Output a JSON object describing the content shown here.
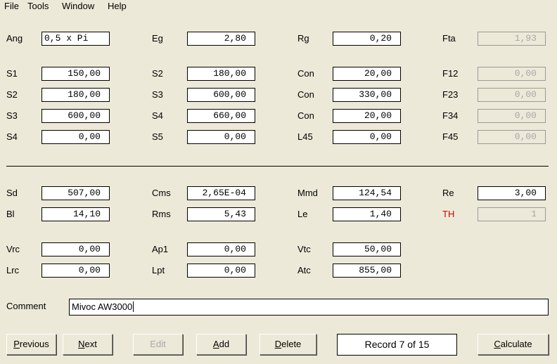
{
  "menu": [
    "File",
    "Tools",
    "Window",
    "Help"
  ],
  "params": {
    "ang": {
      "label": "Ang",
      "value": "0,5 x Pi"
    },
    "eg": {
      "label": "Eg",
      "value": "2,80"
    },
    "rg": {
      "label": "Rg",
      "value": "0,20"
    },
    "fta": {
      "label": "Fta",
      "value": "1,93"
    }
  },
  "segments": [
    {
      "s_a": "S1",
      "v_a": "150,00",
      "s_b": "S2",
      "v_b": "180,00",
      "con": "Con",
      "v_con": "20,00",
      "f": "F12",
      "v_f": "0,00"
    },
    {
      "s_a": "S2",
      "v_a": "180,00",
      "s_b": "S3",
      "v_b": "600,00",
      "con": "Con",
      "v_con": "330,00",
      "f": "F23",
      "v_f": "0,00"
    },
    {
      "s_a": "S3",
      "v_a": "600,00",
      "s_b": "S4",
      "v_b": "660,00",
      "con": "Con",
      "v_con": "20,00",
      "f": "F34",
      "v_f": "0,00"
    },
    {
      "s_a": "S4",
      "v_a": "0,00",
      "s_b": "S5",
      "v_b": "0,00",
      "con": "L45",
      "v_con": "0,00",
      "f": "F45",
      "v_f": "0,00"
    }
  ],
  "driver": {
    "sd": {
      "label": "Sd",
      "value": "507,00"
    },
    "cms": {
      "label": "Cms",
      "value": "2,65E-04"
    },
    "mmd": {
      "label": "Mmd",
      "value": "124,54"
    },
    "re": {
      "label": "Re",
      "value": "3,00"
    },
    "bl": {
      "label": "Bl",
      "value": "14,10"
    },
    "rms": {
      "label": "Rms",
      "value": "5,43"
    },
    "le": {
      "label": "Le",
      "value": "1,40"
    },
    "th": {
      "label": "TH",
      "value": "1",
      "label_color": "#d40000"
    }
  },
  "enclosure": {
    "vrc": {
      "label": "Vrc",
      "value": "0,00"
    },
    "ap1": {
      "label": "Ap1",
      "value": "0,00"
    },
    "vtc": {
      "label": "Vtc",
      "value": "50,00"
    },
    "lrc": {
      "label": "Lrc",
      "value": "0,00"
    },
    "lpt": {
      "label": "Lpt",
      "value": "0,00"
    },
    "atc": {
      "label": "Atc",
      "value": "855,00"
    }
  },
  "comment": {
    "label": "Comment",
    "value": "Mivoc AW3000"
  },
  "buttons": {
    "previous": "Previous",
    "next": "Next",
    "edit": "Edit",
    "add": "Add",
    "delete": "Delete",
    "calculate": "Calculate"
  },
  "record": "Record 7 of 15"
}
